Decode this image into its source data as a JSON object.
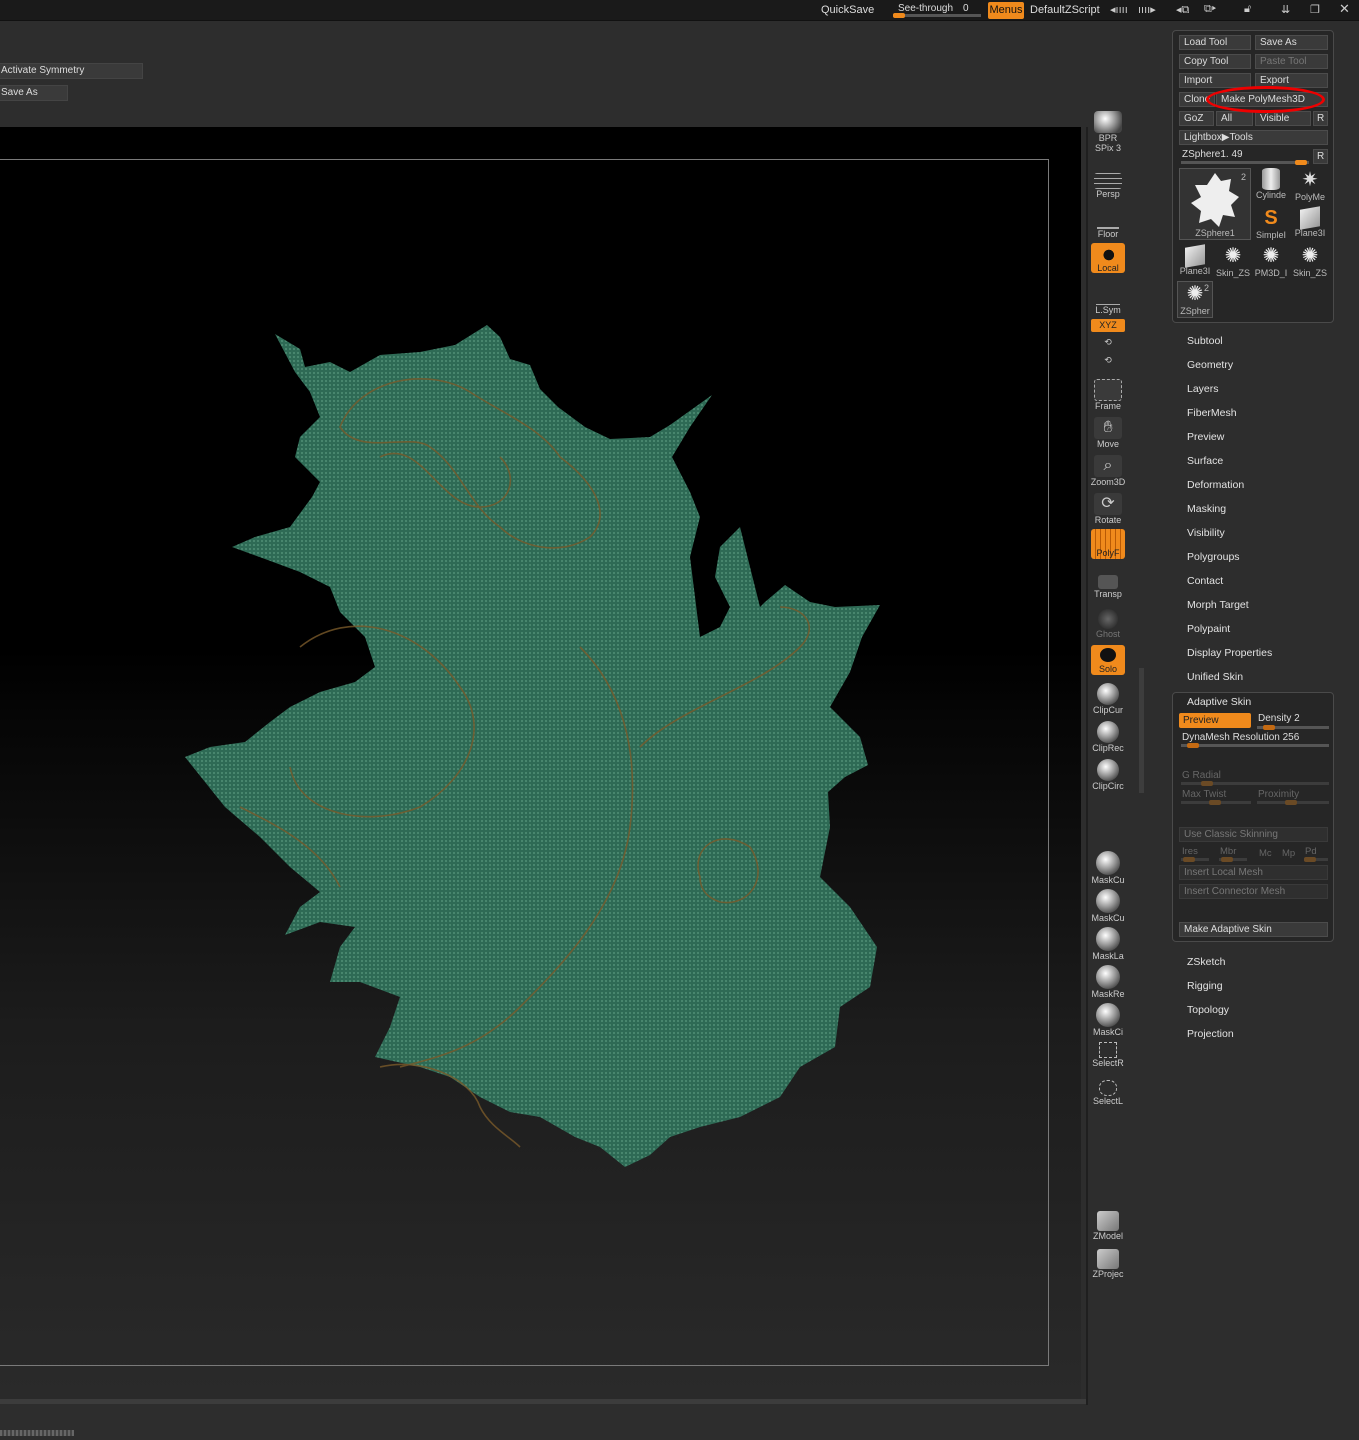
{
  "topbar": {
    "quicksave": "QuickSave",
    "seethrough_label": "See-through",
    "seethrough_value": "0",
    "menus": "Menus",
    "script": "DefaultZScript"
  },
  "left_tools": {
    "activate_symmetry": "Activate Symmetry",
    "save_as": "Save As"
  },
  "right_shelf": [
    {
      "label": "BPR",
      "sub": "SPix 3"
    },
    {
      "label": "Persp"
    },
    {
      "label": "Floor"
    },
    {
      "label": "Local"
    },
    {
      "label": "L.Sym"
    },
    {
      "label": "XYZ"
    },
    {
      "label": "Frame"
    },
    {
      "label": "Move"
    },
    {
      "label": "Zoom3D"
    },
    {
      "label": "Rotate"
    },
    {
      "label": "PolyF"
    },
    {
      "label": "Transp"
    },
    {
      "label": "Ghost"
    },
    {
      "label": "Solo"
    },
    {
      "label": "ClipCur"
    },
    {
      "label": "ClipRec"
    },
    {
      "label": "ClipCirc"
    },
    {
      "label": "MaskCu"
    },
    {
      "label": "MaskCu"
    },
    {
      "label": "MaskLa"
    },
    {
      "label": "MaskRe"
    },
    {
      "label": "MaskCi"
    },
    {
      "label": "SelectR"
    },
    {
      "label": "SelectL"
    },
    {
      "label": "ZModel"
    },
    {
      "label": "ZProjec"
    }
  ],
  "tool_palette": {
    "load_tool": "Load Tool",
    "save_as": "Save As",
    "copy_tool": "Copy Tool",
    "paste_tool": "Paste Tool",
    "import": "Import",
    "export": "Export",
    "clone": "Clone",
    "make_polymesh": "Make PolyMesh3D",
    "goz": "GoZ",
    "all": "All",
    "visible": "Visible",
    "r": "R",
    "lightbox": "Lightbox▶Tools",
    "current_tool": "ZSphere1. 49",
    "thumbs": {
      "main": "ZSphere1",
      "main_count": "2",
      "cylinder": "Cylinde",
      "polymesh": "PolyMe",
      "simple": "SimpleI",
      "plane3d_a": "Plane3I",
      "plane3d_b": "Plane3I",
      "skin_a": "Skin_ZS",
      "pm3d": "PM3D_I",
      "skin_b": "Skin_ZS",
      "zsphere_small": "ZSpher",
      "zsphere_small_count": "2"
    }
  },
  "menu_items": [
    "Subtool",
    "Geometry",
    "Layers",
    "FiberMesh",
    "Preview",
    "Surface",
    "Deformation",
    "Masking",
    "Visibility",
    "Polygroups",
    "Contact",
    "Morph Target",
    "Polypaint",
    "Display Properties",
    "Unified Skin"
  ],
  "adaptive_skin": {
    "title": "Adaptive Skin",
    "preview": "Preview",
    "density": "Density 2",
    "dynamesh": "DynaMesh Resolution 256",
    "g_radial": "G Radial",
    "max_twist": "Max Twist",
    "proximity": "Proximity",
    "use_classic": "Use Classic Skinning",
    "ires": "Ires",
    "mbr": "Mbr",
    "mc": "Mc",
    "mp": "Mp",
    "pd": "Pd",
    "insert_local": "Insert Local Mesh",
    "insert_connector": "Insert Connector Mesh",
    "make_adaptive": "Make Adaptive Skin"
  },
  "menu_items_lower": [
    "ZSketch",
    "Rigging",
    "Topology",
    "Projection"
  ],
  "colors": {
    "accent": "#f08a1c",
    "mesh": "#2f6b55",
    "highlight": "#e00000"
  }
}
